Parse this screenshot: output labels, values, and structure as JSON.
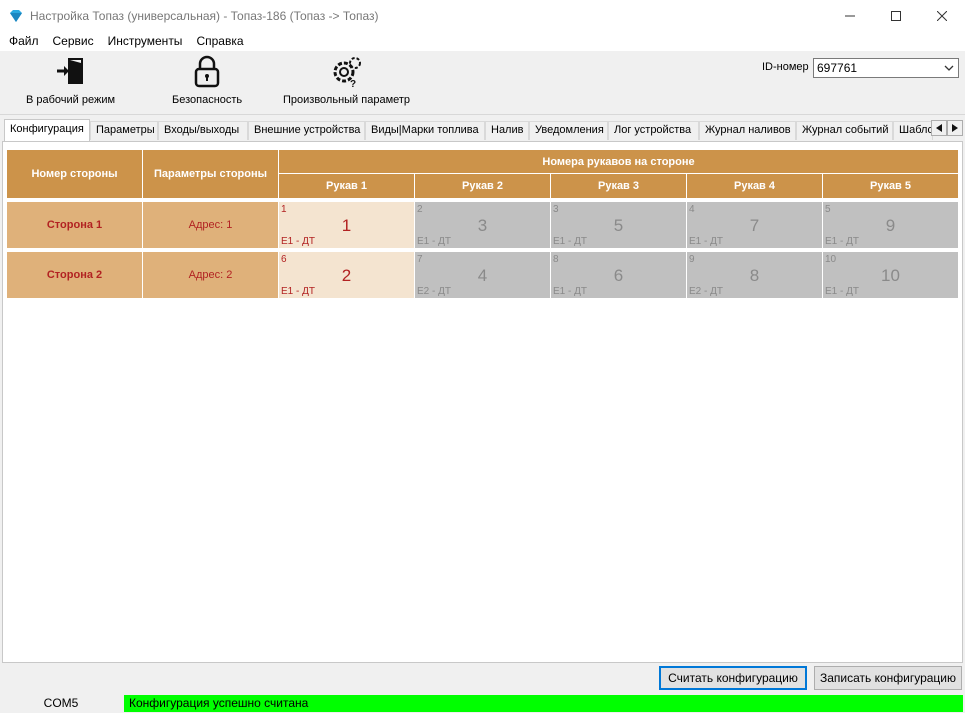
{
  "window": {
    "title": "Настройка Топаз (универсальная) - Топаз-186 (Топаз -> Топаз)"
  },
  "menu": [
    "Файл",
    "Сервис",
    "Инструменты",
    "Справка"
  ],
  "toolbar": {
    "work_mode": "В рабочий режим",
    "security": "Безопасность",
    "custom_param": "Произвольный параметр",
    "id_label": "ID-номер",
    "id_value": "697761"
  },
  "tabs": [
    "Конфигурация",
    "Параметры",
    "Входы/выходы",
    "Внешние устройства",
    "Виды|Марки топлива",
    "Налив",
    "Уведомления",
    "Лог устройства",
    "Журнал наливов",
    "Журнал событий",
    "Шабло"
  ],
  "grid": {
    "side_number_header": "Номер стороны",
    "side_params_header": "Параметры стороны",
    "hoses_header": "Номера рукавов на стороне",
    "hose_headers": [
      "Рукав 1",
      "Рукав 2",
      "Рукав 3",
      "Рукав 4",
      "Рукав 5"
    ],
    "rows": [
      {
        "side": "Сторона 1",
        "param": "Адрес: 1",
        "hoses": [
          {
            "idx": "1",
            "num": "1",
            "fuel": "E1 - ДТ",
            "active": true
          },
          {
            "idx": "2",
            "num": "3",
            "fuel": "E1 - ДТ",
            "active": false
          },
          {
            "idx": "3",
            "num": "5",
            "fuel": "E1 - ДТ",
            "active": false
          },
          {
            "idx": "4",
            "num": "7",
            "fuel": "E1 - ДТ",
            "active": false
          },
          {
            "idx": "5",
            "num": "9",
            "fuel": "E1 - ДТ",
            "active": false
          }
        ]
      },
      {
        "side": "Сторона 2",
        "param": "Адрес: 2",
        "hoses": [
          {
            "idx": "6",
            "num": "2",
            "fuel": "E1 - ДТ",
            "active": true
          },
          {
            "idx": "7",
            "num": "4",
            "fuel": "E2 - ДТ",
            "active": false
          },
          {
            "idx": "8",
            "num": "6",
            "fuel": "E1 - ДТ",
            "active": false
          },
          {
            "idx": "9",
            "num": "8",
            "fuel": "E2 - ДТ",
            "active": false
          },
          {
            "idx": "10",
            "num": "10",
            "fuel": "E1 - ДТ",
            "active": false
          }
        ]
      }
    ]
  },
  "buttons": {
    "read_config": "Считать конфигурацию",
    "write_config": "Записать конфигурацию"
  },
  "status": {
    "port": "COM5",
    "message": "Конфигурация успешно считана"
  },
  "colors": {
    "header": "#cc934a",
    "row_header": "#dfb17a",
    "active_hose": "#f4e4d0",
    "inactive_hose": "#c0c0c0",
    "status_ok": "#00ff00"
  }
}
